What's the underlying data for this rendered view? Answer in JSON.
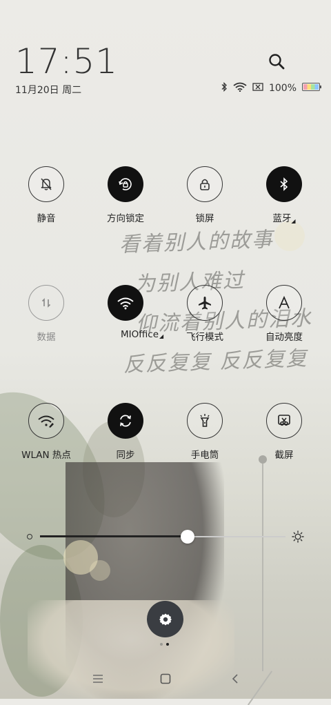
{
  "status_bar": {
    "time": "17:51",
    "date": "11月20日 周二",
    "battery_percent": "100%",
    "icons": [
      "bluetooth-icon",
      "wifi-icon",
      "no-sim-icon",
      "battery-icon"
    ]
  },
  "background": {
    "handwriting": [
      "看着别人的故事",
      "为别人难过",
      "仰流着别人的泪水",
      "反反复复  反反复复"
    ]
  },
  "toggles": [
    {
      "label": "静音",
      "icon": "bell-off-icon",
      "state": "off"
    },
    {
      "label": "方向锁定",
      "icon": "rotation-lock-icon",
      "state": "on"
    },
    {
      "label": "锁屏",
      "icon": "lock-icon",
      "state": "off"
    },
    {
      "label": "蓝牙",
      "icon": "bluetooth-icon",
      "state": "on",
      "has_menu": true
    },
    {
      "label": "数据",
      "icon": "mobile-data-icon",
      "state": "disabled"
    },
    {
      "label": "MIOffice",
      "icon": "wifi-icon",
      "state": "on",
      "has_menu": true
    },
    {
      "label": "飞行模式",
      "icon": "airplane-icon",
      "state": "off"
    },
    {
      "label": "自动亮度",
      "icon": "auto-brightness-icon",
      "state": "off"
    },
    {
      "label": "WLAN 热点",
      "icon": "hotspot-icon",
      "state": "off"
    },
    {
      "label": "同步",
      "icon": "sync-icon",
      "state": "on"
    },
    {
      "label": "手电筒",
      "icon": "flashlight-icon",
      "state": "off"
    },
    {
      "label": "截屏",
      "icon": "screenshot-icon",
      "state": "off"
    }
  ],
  "brightness": {
    "level": 0.6
  },
  "pager": {
    "pages": 2,
    "current": 2
  },
  "colors": {
    "active": "#111111",
    "accent_battery": [
      "#f3a0b0",
      "#fde07a",
      "#a6e3a1",
      "#8ec5ff"
    ]
  }
}
